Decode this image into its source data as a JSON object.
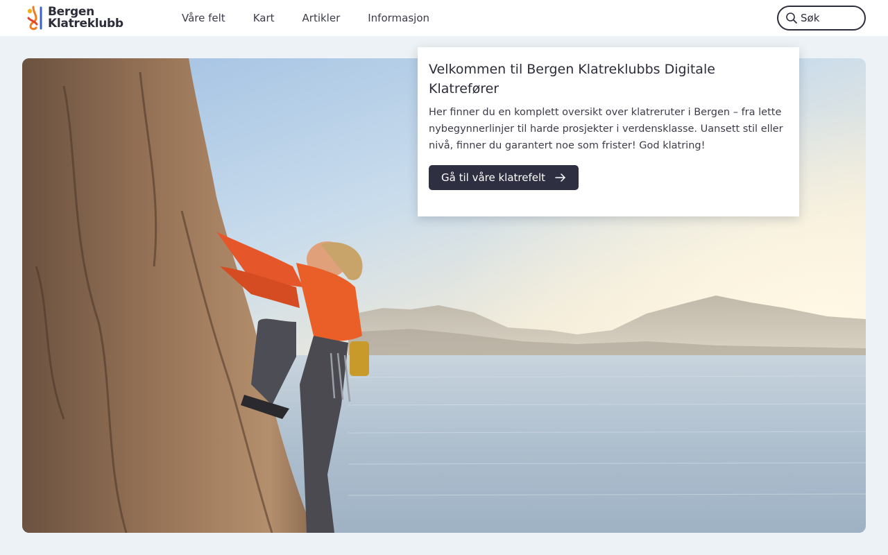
{
  "brand": {
    "line1": "Bergen",
    "line2": "Klatreklubb",
    "colors": {
      "orange": "#f07a1e",
      "yellow": "#f3b11f",
      "blue": "#3b5fd1",
      "red": "#e5422d"
    }
  },
  "nav": {
    "items": [
      {
        "label": "Våre felt"
      },
      {
        "label": "Kart"
      },
      {
        "label": "Artikler"
      },
      {
        "label": "Informasjon"
      }
    ]
  },
  "search": {
    "placeholder": "Søk",
    "icon": "search-icon"
  },
  "hero": {
    "image": "climber-on-rock-by-fjord"
  },
  "welcome": {
    "title": "Velkommen til Bergen Klatreklubbs Digitale Klatrefører",
    "body": "Her finner du en komplett oversikt over klatreruter i Bergen – fra lette nybegynnerlinjer til harde prosjekter i verdensklasse. Uansett stil eller nivå, finner du garantert noe som frister! God klatring!",
    "cta_label": "Gå til våre klatrefelt",
    "cta_icon": "arrow-right-icon"
  },
  "colors": {
    "page_bg": "#ecf2f5",
    "button_bg": "#2e2f41",
    "text": "#2c2d3a"
  }
}
